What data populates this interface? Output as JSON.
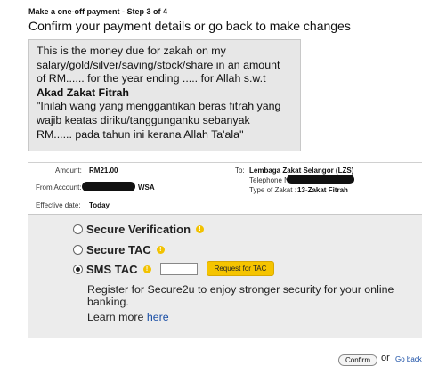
{
  "step_title": "Make a one-off payment - Step 3 of 4",
  "heading": "Confirm your payment details or go back to make changes",
  "note": {
    "lines": [
      "This is the money due for zakah on my",
      "salary/gold/silver/saving/stock/share in an amount",
      "of RM...... for the year ending ..... for Allah s.w.t",
      "Akad Zakat Fitrah",
      "\"Inilah wang yang menggantikan beras fitrah yang",
      "wajib keatas diriku/tanggunganku sebanyak",
      "RM...... pada tahun ini kerana Allah Ta'ala\""
    ]
  },
  "details": {
    "amount_label": "Amount:",
    "amount_value": "RM21.00",
    "from_label": "From Account:",
    "from_value": "WSA",
    "effective_label": "Effective date:",
    "effective_value": "Today",
    "to_label": "To:",
    "to_value": "Lembaga Zakat Selangor (LZS)",
    "telephone_label": "Telephone N",
    "zakat_type_label": "Type of Zakat :",
    "zakat_type_value": "13-Zakat Fitrah"
  },
  "options": {
    "items": [
      {
        "label": "Secure Verification",
        "checked": false
      },
      {
        "label": "Secure TAC",
        "checked": false
      },
      {
        "label": "SMS TAC",
        "checked": true
      }
    ],
    "tac_placeholder": "",
    "request_tac_label": "Request for TAC",
    "register_text": "Register for Secure2u to enjoy stronger security for your online banking.",
    "learn_more_text": "Learn more",
    "learn_more_link": "here"
  },
  "footer": {
    "confirm_label": "Confirm",
    "or_text": "or",
    "go_back_label": "Go back"
  },
  "colors": {
    "accent_yellow": "#f5c400",
    "link_blue": "#1a4fa6",
    "panel_grey": "#ececec"
  }
}
